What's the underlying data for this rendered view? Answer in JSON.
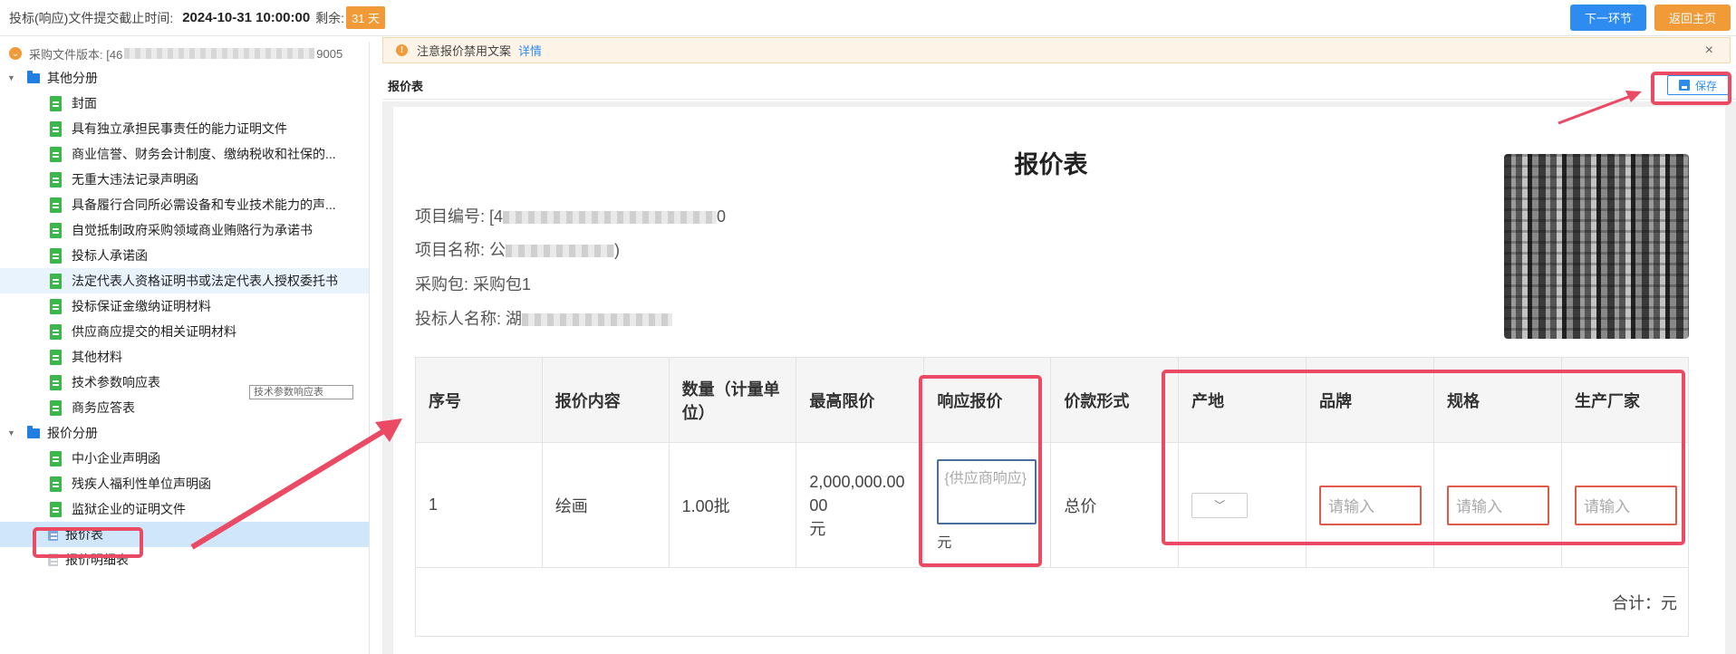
{
  "topbar": {
    "deadline_label": "投标(响应)文件提交截止时间:",
    "deadline_value": "2024-10-31 10:00:00",
    "remaining_label": "剩余:",
    "remaining_value": "31 天",
    "next_button": "下一环节",
    "home_button": "返回主页"
  },
  "sidebar": {
    "version_label": "采购文件版本: [46",
    "version_suffix": "9005",
    "groups": [
      {
        "label": "其他分册",
        "items": [
          "封面",
          "具有独立承担民事责任的能力证明文件",
          "商业信誉、财务会计制度、缴纳税收和社保的...",
          "无重大违法记录声明函",
          "具备履行合同所必需设备和专业技术能力的声...",
          "自觉抵制政府采购领域商业贿赂行为承诺书",
          "投标人承诺函",
          "法定代表人资格证明书或法定代表人授权委托书",
          "投标保证金缴纳证明材料",
          "供应商应提交的相关证明材料",
          "其他材料",
          "技术参数响应表",
          "商务应答表"
        ]
      },
      {
        "label": "报价分册",
        "items": [
          "中小企业声明函",
          "残疾人福利性单位声明函",
          "监狱企业的证明文件",
          "报价表",
          "报价明细表"
        ]
      }
    ],
    "tooltip_ghost": "技术参数响应表"
  },
  "notice": {
    "text": "注意报价禁用文案",
    "link": "详情",
    "close": "×"
  },
  "sheet": {
    "tab_title": "报价表",
    "save_label": "保存",
    "title": "报价表",
    "project_no_label": "项目编号:",
    "project_no_prefix": "[4",
    "project_no_suffix": "0",
    "project_name_label": "项目名称:",
    "project_name_prefix": "公",
    "project_name_suffix": ")",
    "package_label": "采购包:",
    "package_value": "采购包1",
    "bidder_label": "投标人名称:",
    "bidder_prefix": "湖"
  },
  "table": {
    "headers": [
      "序号",
      "报价内容",
      "数量（计量单位）",
      "最高限价",
      "响应报价",
      "价款形式",
      "产地",
      "品牌",
      "规格",
      "生产厂家"
    ],
    "row": {
      "index": "1",
      "content": "绘画",
      "quantity": "1.00批",
      "max_price": "2,000,000.0000",
      "max_price_unit": "元",
      "response_placeholder": "{供应商响应}",
      "response_unit": "元",
      "price_form": "总价",
      "brand_placeholder": "请输入",
      "spec_placeholder": "请输入",
      "manufacturer_placeholder": "请输入"
    },
    "total_label": "合计：元"
  },
  "colors": {
    "primary": "#2e8cf0",
    "orange": "#f19a38",
    "annotation_red": "#ea4a63",
    "file_green": "#3cb84a"
  }
}
